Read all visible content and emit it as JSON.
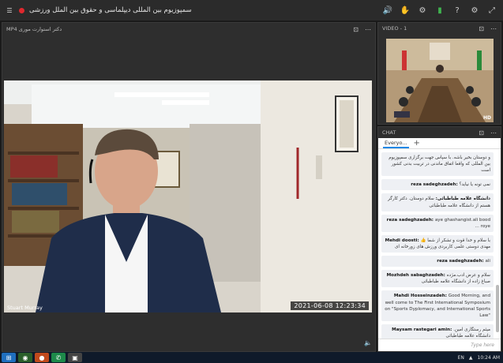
{
  "topbar": {
    "title": "سمپوزیوم بین المللی دیپلماسی و حقوق بین الملل ورزشی",
    "icons": [
      "record-dot",
      "volume-icon",
      "hand-raise-icon",
      "settings-icon",
      "signal-icon",
      "help-icon",
      "fullscreen-icon"
    ]
  },
  "main": {
    "header": "MP4 دکتر استوارت موری",
    "speaker": "Stuart Murray",
    "timestamp": "2021-06-08  12:23:34"
  },
  "video_panel": {
    "title": "VIDEO - 1",
    "badge": "HD"
  },
  "chat": {
    "title": "CHAT",
    "tab": "Everyo...",
    "placeholder": "Type here",
    "messages": [
      {
        "text": "و دوستان بخیر باشه. با سپاس جهت برگزاری سمپوزیوم بین المللی که واقعا اتفاق ماندنی در تربیت بدنی کشور است"
      },
      {
        "name": "reza sadeghzadeh:",
        "text": "نمی تونه یا نیاید؟"
      },
      {
        "name": "دانشگاه علامه طباطبائی:",
        "text": "سلام دوستان. دکتر کارگر هستم از دانشگاه علامه طباطبائی"
      },
      {
        "name": "reza sadeghzadeh:",
        "text": "aye ghashangist.ali bood ... roye"
      },
      {
        "name": "Mehdi doosti:",
        "text": "با سلام و خدا قوت و تشکر از شما 👍 مهدی دوستی علمی کاربردی ورزش های زورخانه ای"
      },
      {
        "name": "reza sadeghzadeh:",
        "text": "ali"
      },
      {
        "name": "Mozhdeh sabaghzadeh:",
        "text": "سلام و عرض ادب.مژده صباغ زاده از دانشگاه علامه طباطبائی"
      },
      {
        "name": "Mahdi Hosseinzadeh:",
        "text": "Good Morning, and well come to The First International Symposium on \"Sports Dyplomacy, and International Sports Law\""
      },
      {
        "name": "Maysam rastegari amin:",
        "text": "میثم رستگاری امین. دانشگاه علامه طباطبائی"
      }
    ]
  },
  "tray": {
    "lang": "EN",
    "time": "10:24 AM"
  }
}
